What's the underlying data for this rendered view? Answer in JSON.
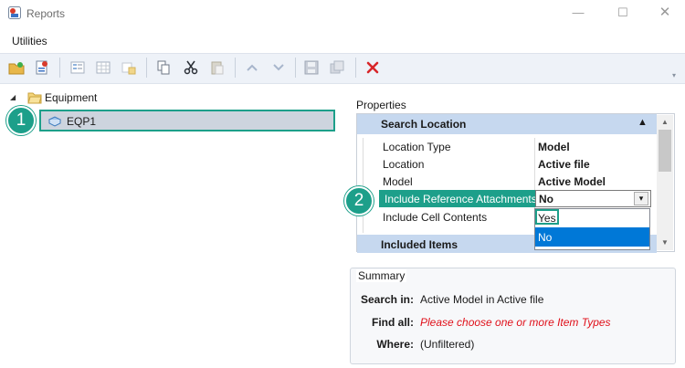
{
  "window": {
    "title": "Reports"
  },
  "menu": {
    "items": [
      "Utilities"
    ]
  },
  "tree": {
    "root": {
      "label": "Equipment"
    },
    "child": {
      "label": "EQP1"
    }
  },
  "callouts": {
    "one": "1",
    "two": "2"
  },
  "properties": {
    "title": "Properties",
    "section1": {
      "title": "Search Location"
    },
    "rows": [
      {
        "label": "Location Type",
        "value": "Model"
      },
      {
        "label": "Location",
        "value": "Active file"
      },
      {
        "label": "Model",
        "value": "Active Model"
      },
      {
        "label": "Include Reference Attachments",
        "value": "No"
      },
      {
        "label": "Include Cell Contents",
        "value": ""
      }
    ],
    "section2": {
      "title": "Included Items"
    },
    "dropdown": {
      "options": [
        "Yes",
        "No"
      ],
      "selected": "No"
    }
  },
  "summary": {
    "title": "Summary",
    "search_in_label": "Search in:",
    "search_in_value": "Active Model  in Active file",
    "find_all_label": "Find all:",
    "find_all_value": "Please choose one or more Item Types",
    "where_label": "Where:",
    "where_value": "(Unfiltered)"
  },
  "colors": {
    "accent": "#1d9f8a",
    "section_header": "#c6d8ef",
    "selection": "#0078d7",
    "warning_text": "#e0101a"
  }
}
